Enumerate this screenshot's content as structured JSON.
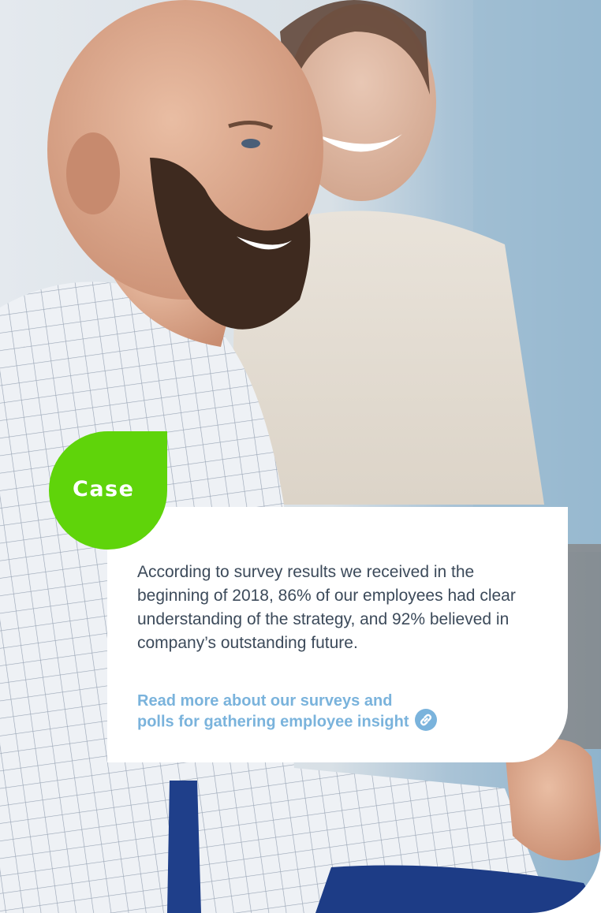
{
  "case_badge": {
    "label": "Case",
    "color": "#5fd40a"
  },
  "card": {
    "body_text": "According to survey results we received in the beginning of 2018, 86% of our employees had clear understanding of the strategy, and 92% believed in company’s outstanding future.",
    "link_line_1": "Read more about our surveys and",
    "link_line_2": "polls for gathering employee insight",
    "link_icon": "chain-link-icon",
    "link_color": "#7ab3dc"
  },
  "photo": {
    "icon": "photo-of-two-smiling-colleagues"
  }
}
